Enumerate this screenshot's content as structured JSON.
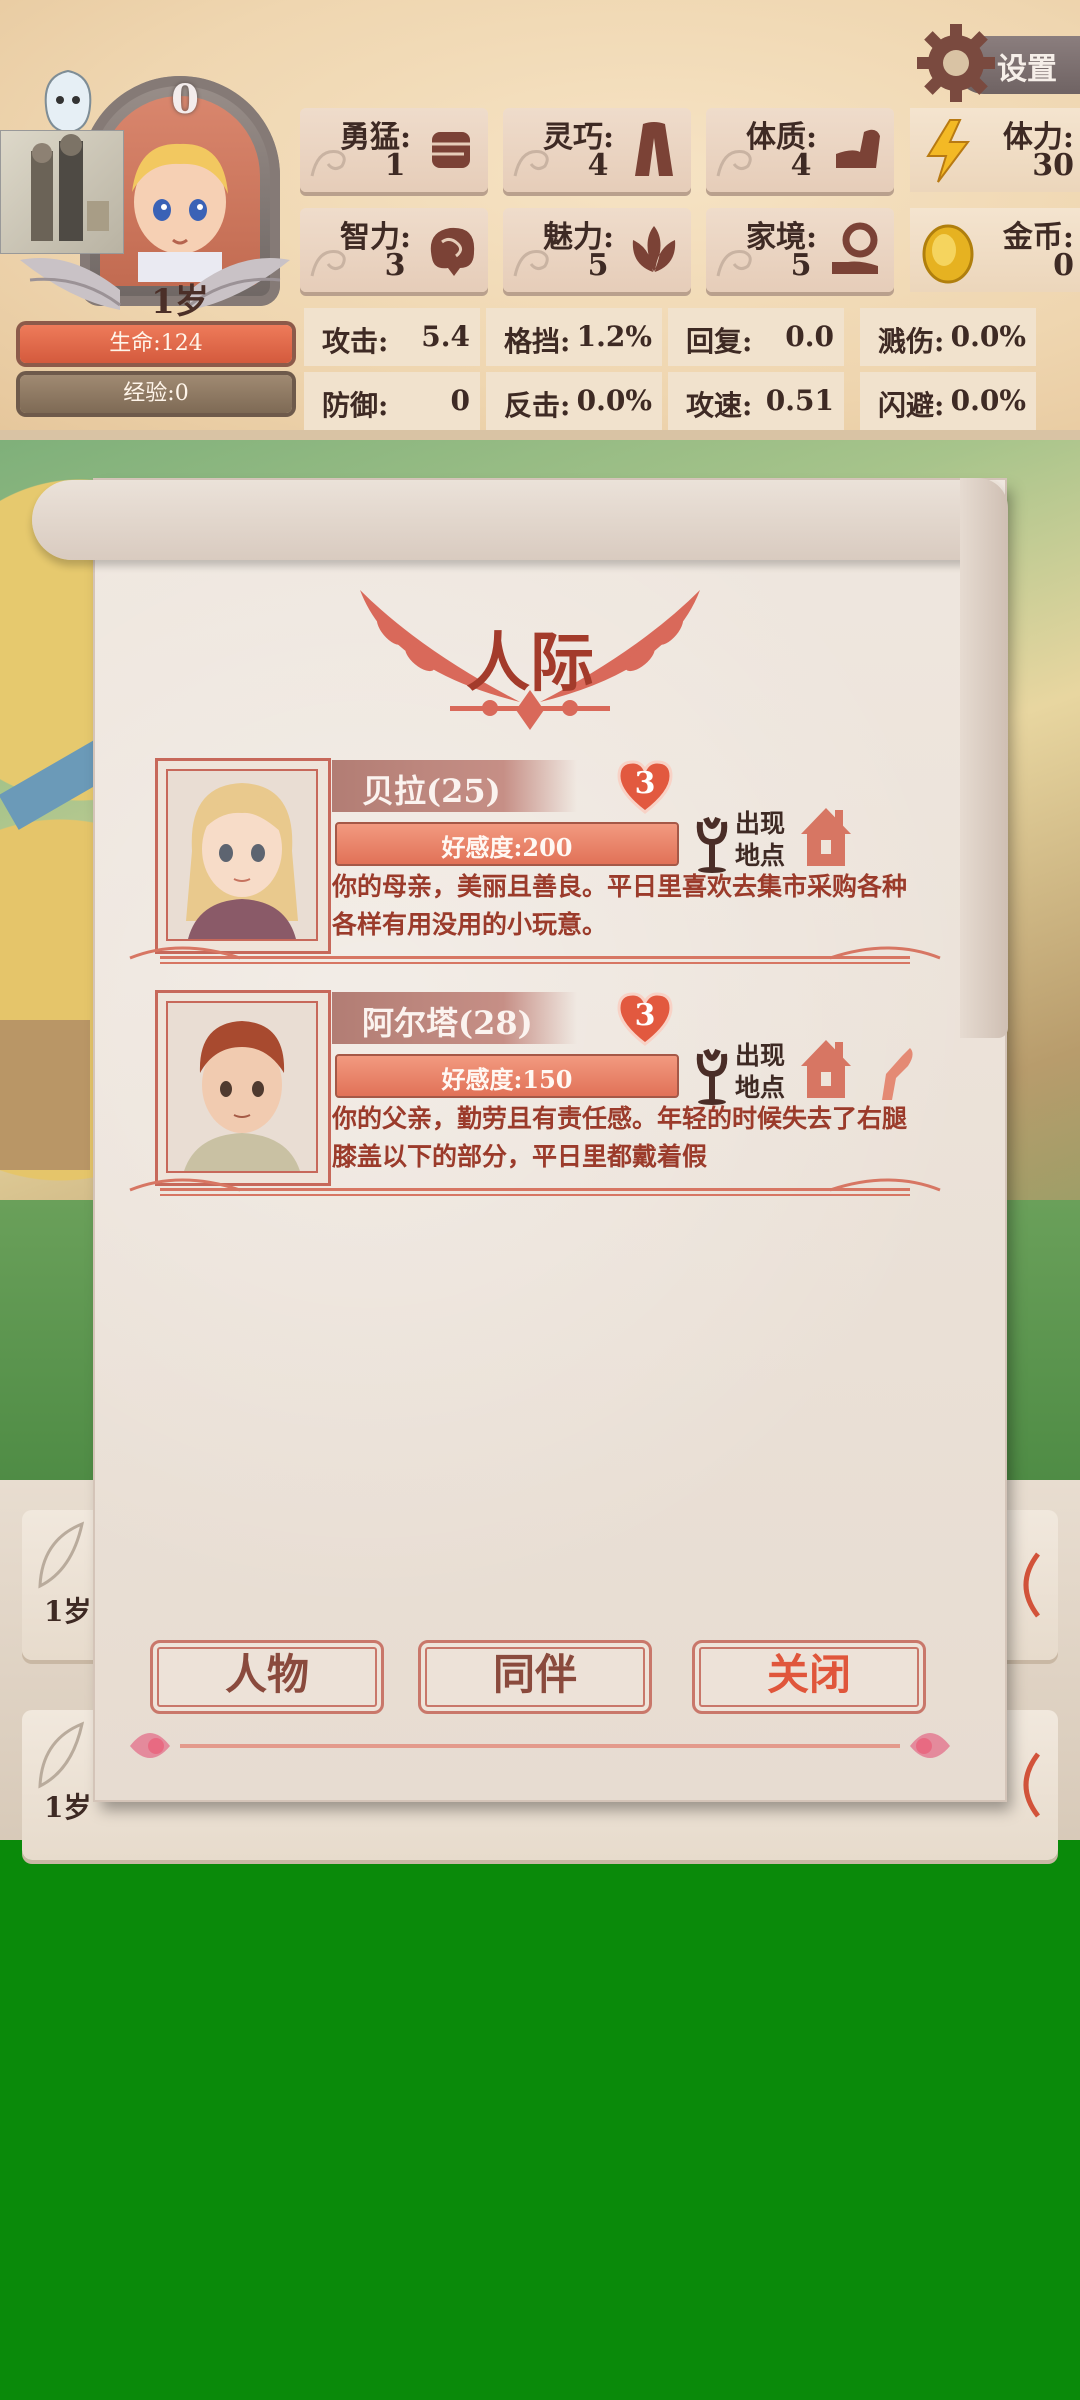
{
  "settings": {
    "label": "设置"
  },
  "player": {
    "level": "0",
    "age": "1岁",
    "hp": "生命:124",
    "exp": "经验:0"
  },
  "attributes": [
    {
      "label": "勇猛:",
      "value": "1",
      "icon": "fist-icon"
    },
    {
      "label": "灵巧:",
      "value": "4",
      "icon": "cloak-icon"
    },
    {
      "label": "体质:",
      "value": "4",
      "icon": "arm-icon"
    },
    {
      "label": "智力:",
      "value": "3",
      "icon": "brain-icon"
    },
    {
      "label": "魅力:",
      "value": "5",
      "icon": "lotus-icon"
    },
    {
      "label": "家境:",
      "value": "5",
      "icon": "coin-hand-icon"
    }
  ],
  "resources": {
    "stamina": {
      "label": "体力:",
      "value": "30",
      "icon": "lightning-icon"
    },
    "gold": {
      "label": "金币:",
      "value": "0",
      "icon": "gold-coin-icon"
    }
  },
  "combat": [
    {
      "label": "攻击:",
      "value": "5.4"
    },
    {
      "label": "格挡:",
      "value": "1.2%"
    },
    {
      "label": "回复:",
      "value": "0.0"
    },
    {
      "label": "溅伤:",
      "value": "0.0%"
    },
    {
      "label": "防御:",
      "value": "0"
    },
    {
      "label": "反击:",
      "value": "0.0%"
    },
    {
      "label": "攻速:",
      "value": "0.51"
    },
    {
      "label": "闪避:",
      "value": "0.0%"
    }
  ],
  "background_events": [
    {
      "age": "1岁"
    },
    {
      "age": "1岁"
    }
  ],
  "modal": {
    "title": "人际",
    "characters": [
      {
        "name": "贝拉(25)",
        "hearts": "3",
        "favor_text": "好感度:200",
        "favor_ratio": 1.0,
        "location_label_1": "出现",
        "location_label_2": "地点",
        "description": "你的母亲，美丽且善良。平日里喜欢去集市采购各种各样有用没用的小玩意。",
        "location_icons": [
          "house-icon"
        ]
      },
      {
        "name": "阿尔塔(28)",
        "hearts": "3",
        "favor_text": "好感度:150",
        "favor_ratio": 1.0,
        "location_label_1": "出现",
        "location_label_2": "地点",
        "description": "你的父亲，勤劳且有责任感。年轻的时候失去了右腿膝盖以下的部分，平日里都戴着假",
        "location_icons": [
          "house-icon",
          "prosthetic-leg-icon"
        ]
      }
    ],
    "buttons": {
      "characters": "人物",
      "companions": "同伴",
      "close": "关闭"
    }
  },
  "colors": {
    "accent_red": "#a33b2b",
    "hp_bar": "#e06a4a",
    "exp_bar": "#8a7560",
    "scroll_paper": "#ebe2d9",
    "background_green": "#0a8a0a"
  }
}
